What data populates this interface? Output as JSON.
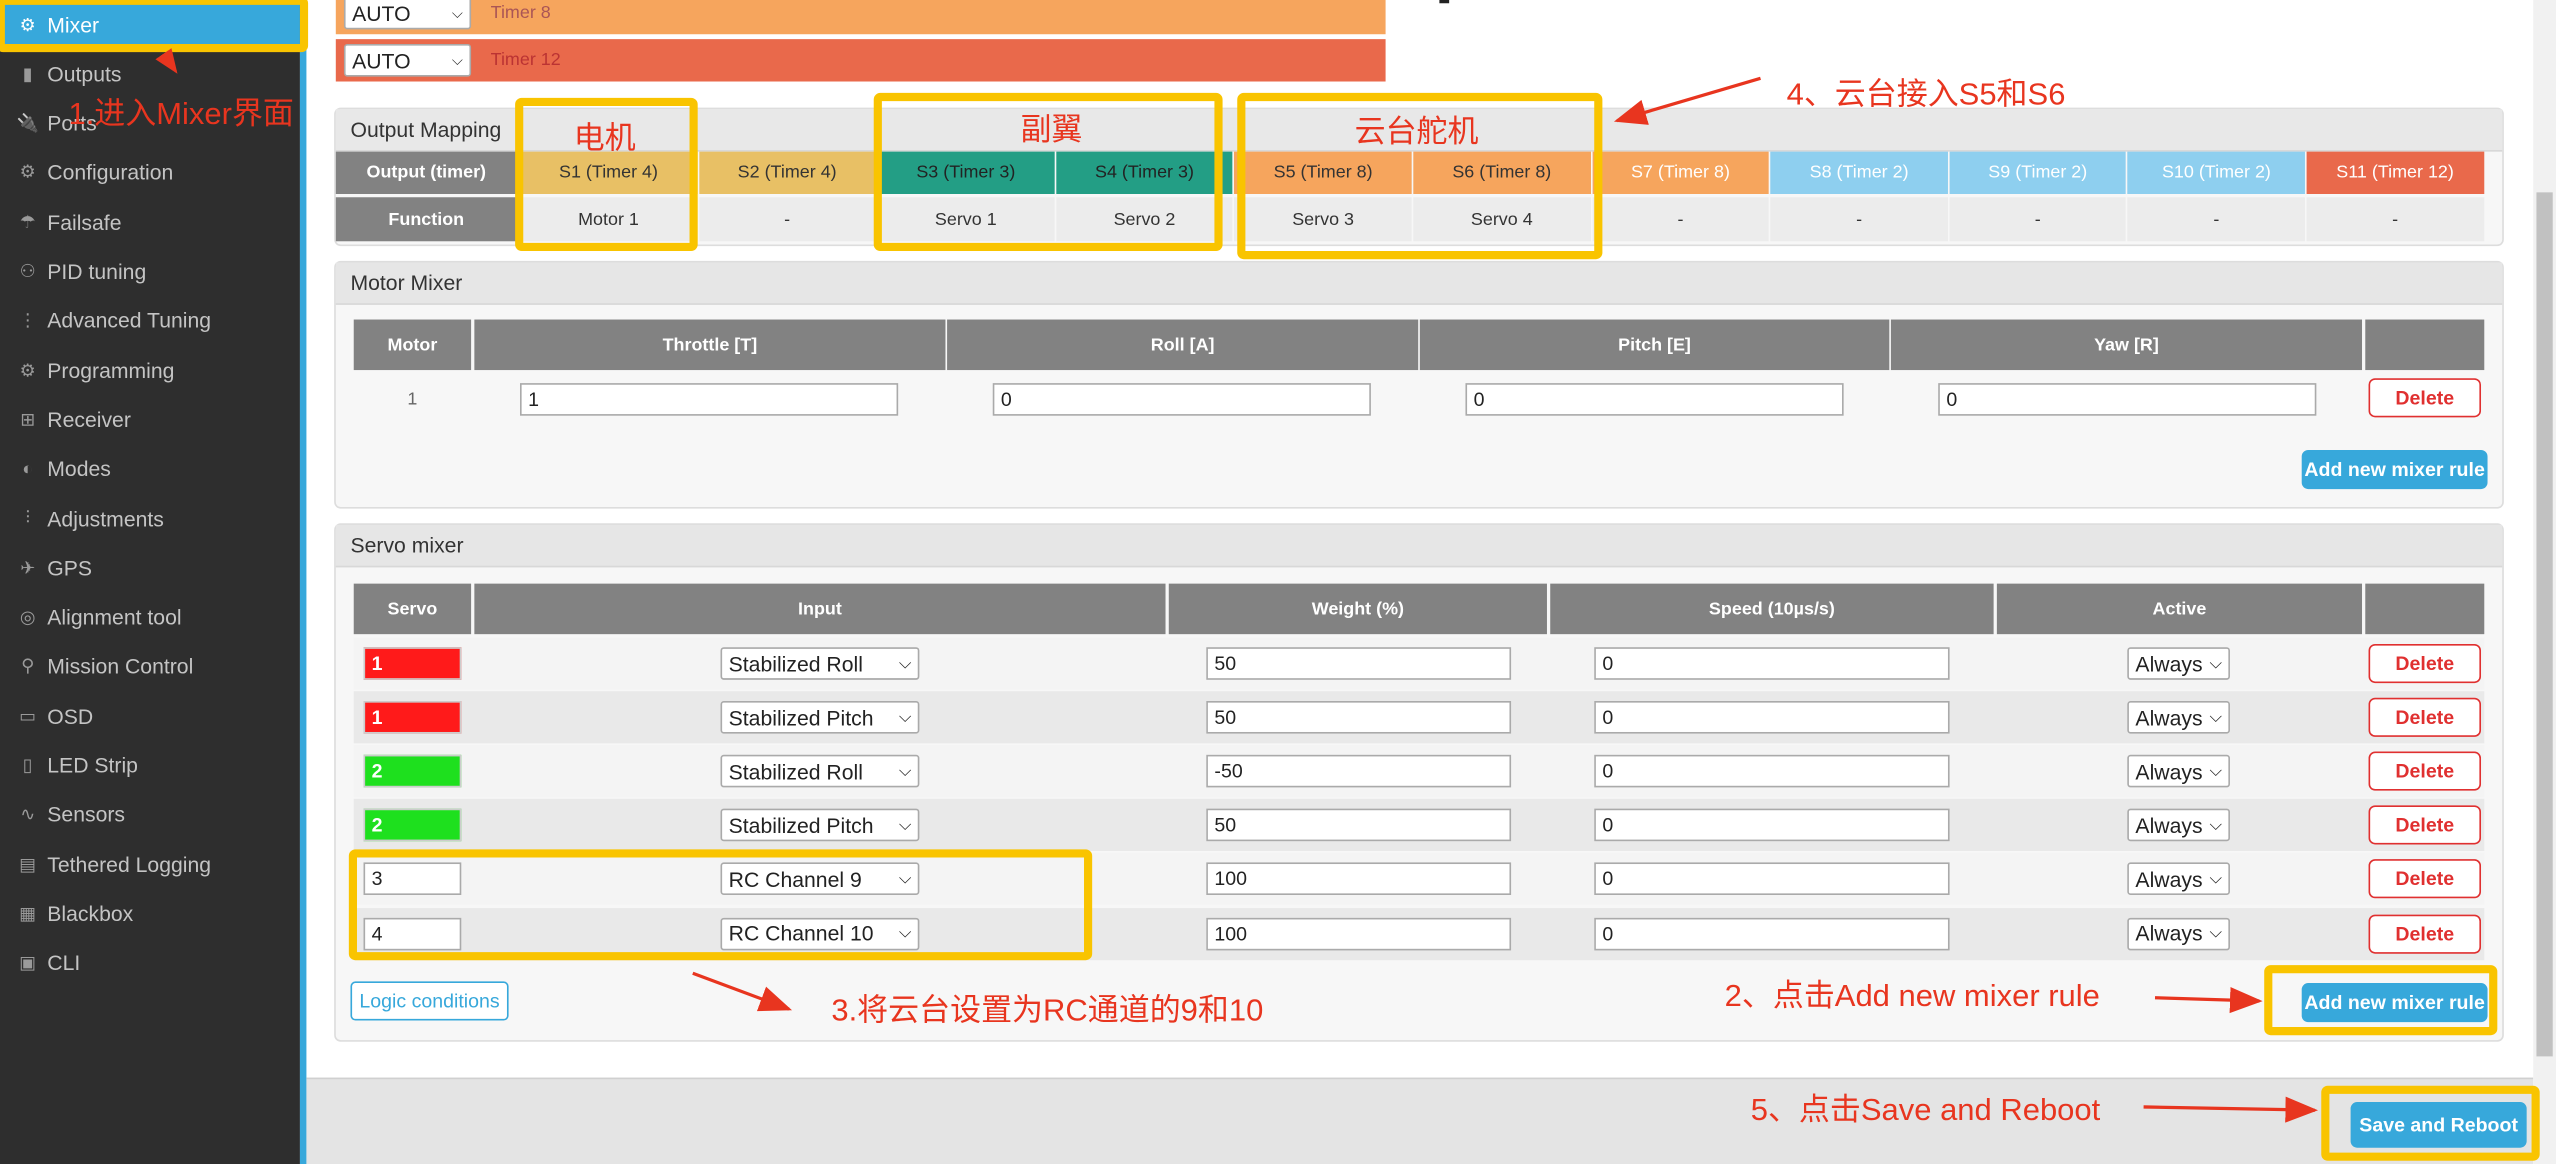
{
  "sidebar": {
    "items": [
      {
        "label": "Mixer",
        "icon": "mixer-icon"
      },
      {
        "label": "Outputs",
        "icon": "outputs-icon"
      },
      {
        "label": "Ports",
        "icon": "ports-icon"
      },
      {
        "label": "Configuration",
        "icon": "gear-icon"
      },
      {
        "label": "Failsafe",
        "icon": "parachute-icon"
      },
      {
        "label": "PID tuning",
        "icon": "pid-icon"
      },
      {
        "label": "Advanced Tuning",
        "icon": "tree-icon"
      },
      {
        "label": "Programming",
        "icon": "gear-icon"
      },
      {
        "label": "Receiver",
        "icon": "receiver-icon"
      },
      {
        "label": "Modes",
        "icon": "toggle-icon"
      },
      {
        "label": "Adjustments",
        "icon": "sliders-icon"
      },
      {
        "label": "GPS",
        "icon": "satellite-icon"
      },
      {
        "label": "Alignment tool",
        "icon": "compass-icon"
      },
      {
        "label": "Mission Control",
        "icon": "map-pin-icon"
      },
      {
        "label": "OSD",
        "icon": "osd-icon"
      },
      {
        "label": "LED Strip",
        "icon": "led-icon"
      },
      {
        "label": "Sensors",
        "icon": "sensors-icon"
      },
      {
        "label": "Tethered Logging",
        "icon": "logging-icon"
      },
      {
        "label": "Blackbox",
        "icon": "blackbox-icon"
      },
      {
        "label": "CLI",
        "icon": "terminal-icon"
      }
    ],
    "active": "Mixer"
  },
  "timers": [
    {
      "mode": "AUTO",
      "label": "Timer 8",
      "color": "#f6a55d"
    },
    {
      "mode": "AUTO",
      "label": "Timer 12",
      "color": "#e9694b"
    }
  ],
  "output_mapping": {
    "title": "Output Mapping",
    "row_output": "Output (timer)",
    "row_function": "Function",
    "columns": [
      {
        "output": "S1 (Timer 4)",
        "function": "Motor 1",
        "color": "#e8c065",
        "text": "#333"
      },
      {
        "output": "S2 (Timer 4)",
        "function": "-",
        "color": "#e8c065",
        "text": "#333"
      },
      {
        "output": "S3 (Timer 3)",
        "function": "Servo 1",
        "color": "#239e85",
        "text": "#222"
      },
      {
        "output": "S4 (Timer 3)",
        "function": "Servo 2",
        "color": "#239e85",
        "text": "#222"
      },
      {
        "output": "S5 (Timer 8)",
        "function": "Servo 3",
        "color": "#f6a55d",
        "text": "#333"
      },
      {
        "output": "S6 (Timer 8)",
        "function": "Servo 4",
        "color": "#f6a55d",
        "text": "#333"
      },
      {
        "output": "S7 (Timer 8)",
        "function": "-",
        "color": "#f6a55d",
        "text": "#fff"
      },
      {
        "output": "S8 (Timer 2)",
        "function": "-",
        "color": "#8ecfef",
        "text": "#fff"
      },
      {
        "output": "S9 (Timer 2)",
        "function": "-",
        "color": "#8ecfef",
        "text": "#fff"
      },
      {
        "output": "S10 (Timer 2)",
        "function": "-",
        "color": "#8ecfef",
        "text": "#fff"
      },
      {
        "output": "S11 (Timer 12)",
        "function": "-",
        "color": "#e9694b",
        "text": "#fff"
      }
    ]
  },
  "motor_mixer": {
    "title": "Motor Mixer",
    "headers": [
      "Motor",
      "Throttle [T]",
      "Roll [A]",
      "Pitch [E]",
      "Yaw [R]"
    ],
    "rows": [
      {
        "motor": "1",
        "throttle": "1",
        "roll": "0",
        "pitch": "0",
        "yaw": "0"
      }
    ],
    "delete_label": "Delete",
    "add_label": "Add new mixer rule"
  },
  "servo_mixer": {
    "title": "Servo mixer",
    "headers": [
      "Servo",
      "Input",
      "Weight (%)",
      "Speed (10µs/s)",
      "Active"
    ],
    "rows": [
      {
        "servo": "1",
        "servo_style": "red",
        "input": "Stabilized Roll",
        "weight": "50",
        "speed": "0",
        "active": "Always"
      },
      {
        "servo": "1",
        "servo_style": "red",
        "input": "Stabilized Pitch",
        "weight": "50",
        "speed": "0",
        "active": "Always"
      },
      {
        "servo": "2",
        "servo_style": "green",
        "input": "Stabilized Roll",
        "weight": "-50",
        "speed": "0",
        "active": "Always"
      },
      {
        "servo": "2",
        "servo_style": "green",
        "input": "Stabilized Pitch",
        "weight": "50",
        "speed": "0",
        "active": "Always"
      },
      {
        "servo": "3",
        "servo_style": "input",
        "input": "RC Channel 9",
        "weight": "100",
        "speed": "0",
        "active": "Always"
      },
      {
        "servo": "4",
        "servo_style": "input",
        "input": "RC Channel 10",
        "weight": "100",
        "speed": "0",
        "active": "Always"
      }
    ],
    "delete_label": "Delete",
    "logic_label": "Logic conditions",
    "add_label": "Add new mixer rule"
  },
  "save_label": "Save and Reboot",
  "annotations": {
    "step1": "1.进入Mixer界面",
    "step2": "2、点击Add new mixer rule",
    "step3": "3.将云台设置为RC通道的9和10",
    "step4": "4、云台接入S5和S6",
    "step5": "5、点击Save and Reboot",
    "motor": "电机",
    "aileron": "副翼",
    "gimbal": "云台舵机"
  },
  "colors": {
    "accent": "#37a8db",
    "annotation": "#e8351f",
    "highlight": "#f9c400",
    "delete": "#e03030"
  }
}
